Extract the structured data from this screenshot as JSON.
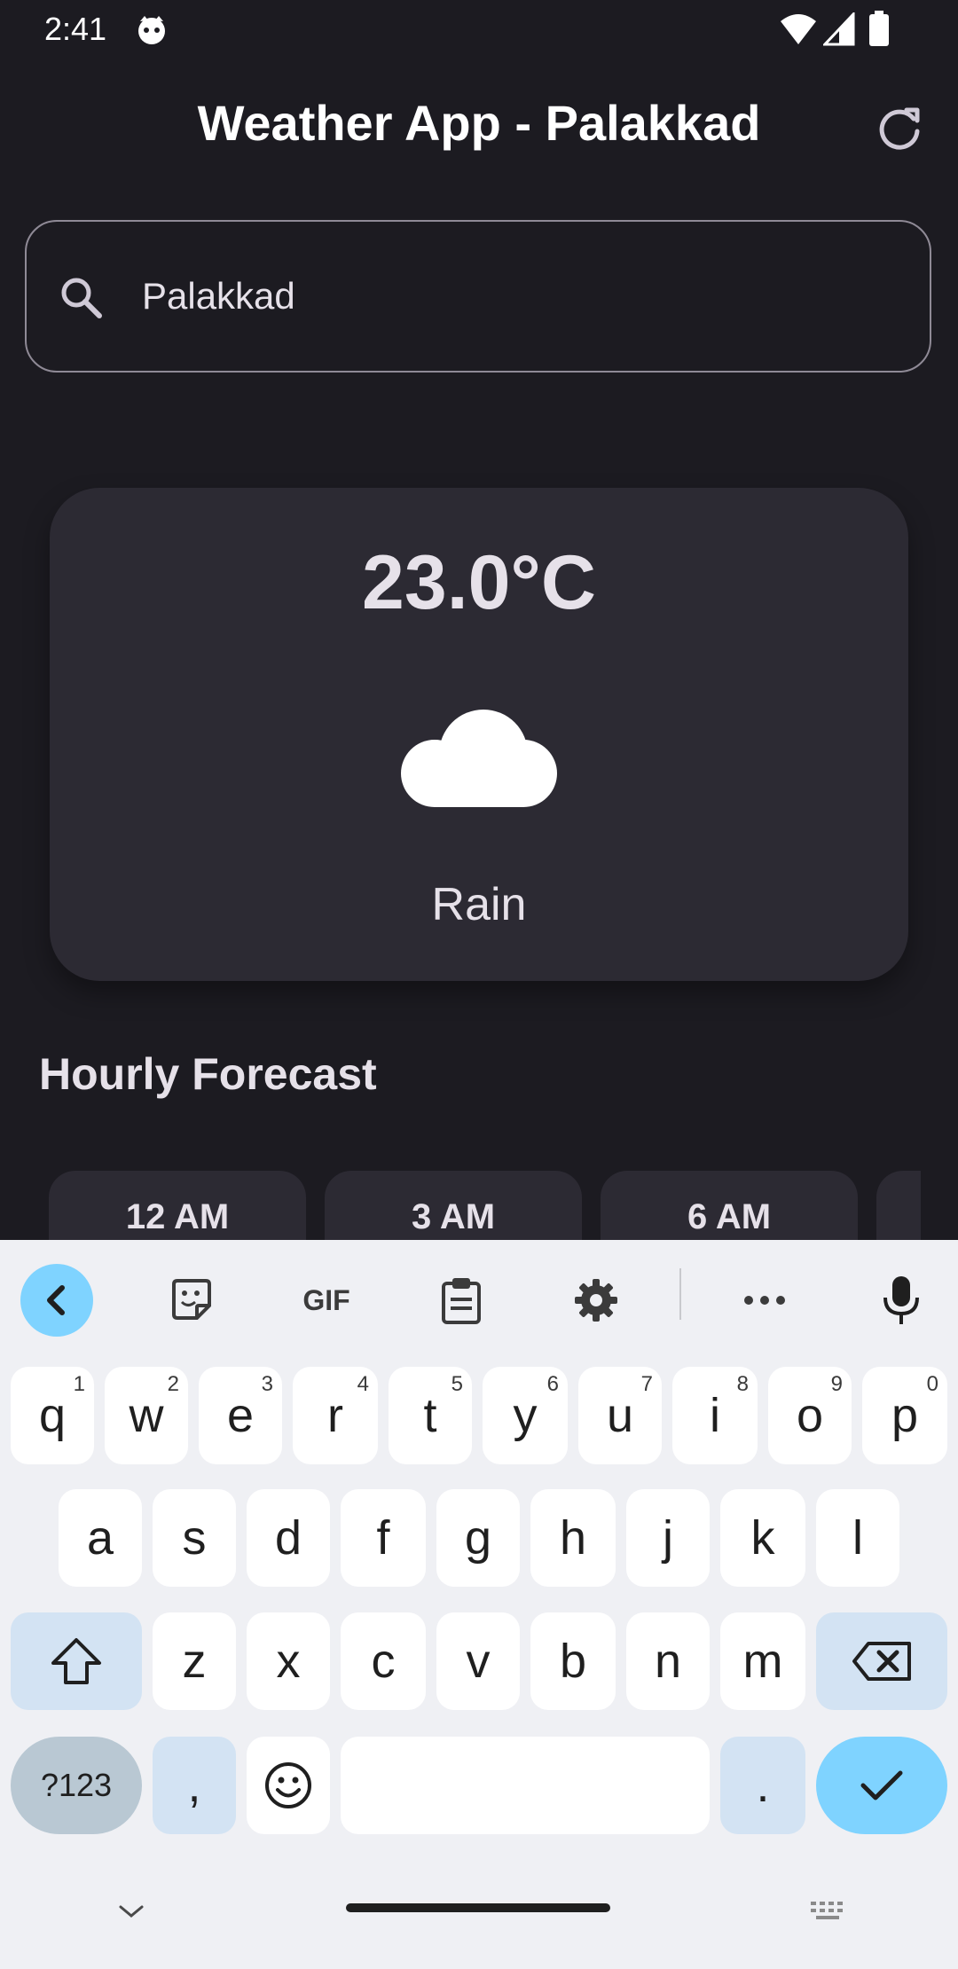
{
  "status_bar": {
    "time": "2:41"
  },
  "app_bar": {
    "title": "Weather App - Palakkad"
  },
  "search": {
    "value": "Palakkad",
    "placeholder": ""
  },
  "weather": {
    "temperature": "23.0°C",
    "condition": "Rain"
  },
  "hourly": {
    "title": "Hourly Forecast",
    "items": [
      {
        "time": "12 AM"
      },
      {
        "time": "3 AM"
      },
      {
        "time": "6 AM"
      }
    ]
  },
  "keyboard": {
    "toolbar": {
      "gif_label": "GIF"
    },
    "row1": [
      {
        "key": "q",
        "hint": "1"
      },
      {
        "key": "w",
        "hint": "2"
      },
      {
        "key": "e",
        "hint": "3"
      },
      {
        "key": "r",
        "hint": "4"
      },
      {
        "key": "t",
        "hint": "5"
      },
      {
        "key": "y",
        "hint": "6"
      },
      {
        "key": "u",
        "hint": "7"
      },
      {
        "key": "i",
        "hint": "8"
      },
      {
        "key": "o",
        "hint": "9"
      },
      {
        "key": "p",
        "hint": "0"
      }
    ],
    "row2": [
      "a",
      "s",
      "d",
      "f",
      "g",
      "h",
      "j",
      "k",
      "l"
    ],
    "row3": [
      "z",
      "x",
      "c",
      "v",
      "b",
      "n",
      "m"
    ],
    "symbols_label": "?123",
    "comma": ",",
    "period": "."
  },
  "colors": {
    "background": "#1c1b21",
    "card": "#2c2a33",
    "accent": "#7fd3ff"
  }
}
